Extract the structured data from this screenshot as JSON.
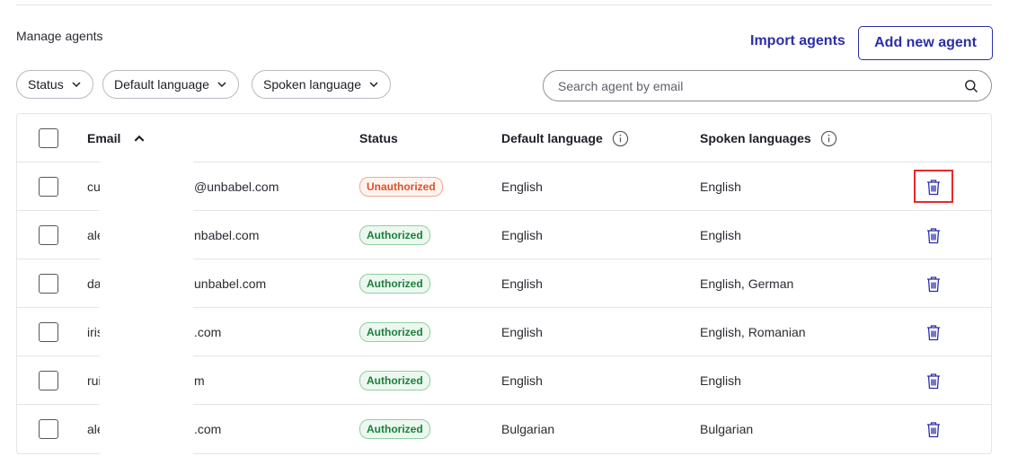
{
  "page": {
    "title": "Manage agents"
  },
  "actions": {
    "import_label": "Import agents",
    "add_label": "Add new agent"
  },
  "filters": [
    {
      "label": "Status"
    },
    {
      "label": "Default language"
    },
    {
      "label": "Spoken language"
    }
  ],
  "search": {
    "placeholder": "Search agent by email",
    "value": ""
  },
  "table": {
    "headers": {
      "email": "Email",
      "status": "Status",
      "default_language": "Default language",
      "spoken_languages": "Spoken languages"
    },
    "sort": {
      "column": "Email",
      "direction": "ascending"
    },
    "rows": [
      {
        "email_start": "cu",
        "email_end": "@unbabel.com",
        "status": "Unauthorized",
        "default_language": "English",
        "spoken_languages": "English"
      },
      {
        "email_start": "ale",
        "email_end": "nbabel.com",
        "status": "Authorized",
        "default_language": "English",
        "spoken_languages": "English"
      },
      {
        "email_start": "da",
        "email_end": "unbabel.com",
        "status": "Authorized",
        "default_language": "English",
        "spoken_languages": "English, German"
      },
      {
        "email_start": "iris",
        "email_end": ".com",
        "status": "Authorized",
        "default_language": "English",
        "spoken_languages": "English, Romanian"
      },
      {
        "email_start": "rui",
        "email_end": "m",
        "status": "Authorized",
        "default_language": "English",
        "spoken_languages": "English"
      },
      {
        "email_start": "ale",
        "email_end": ".com",
        "status": "Authorized",
        "default_language": "Bulgarian",
        "spoken_languages": "Bulgarian"
      }
    ]
  },
  "colors": {
    "accent": "#2c2ea8",
    "unauthorized": "#d9532a",
    "authorized": "#1b7f3c",
    "highlight": "#e52a2a"
  },
  "icons": {
    "sort": "chevron-up-icon",
    "filter": "chevron-down-icon",
    "search": "search-icon",
    "info": "info-icon",
    "delete": "trash-icon"
  }
}
